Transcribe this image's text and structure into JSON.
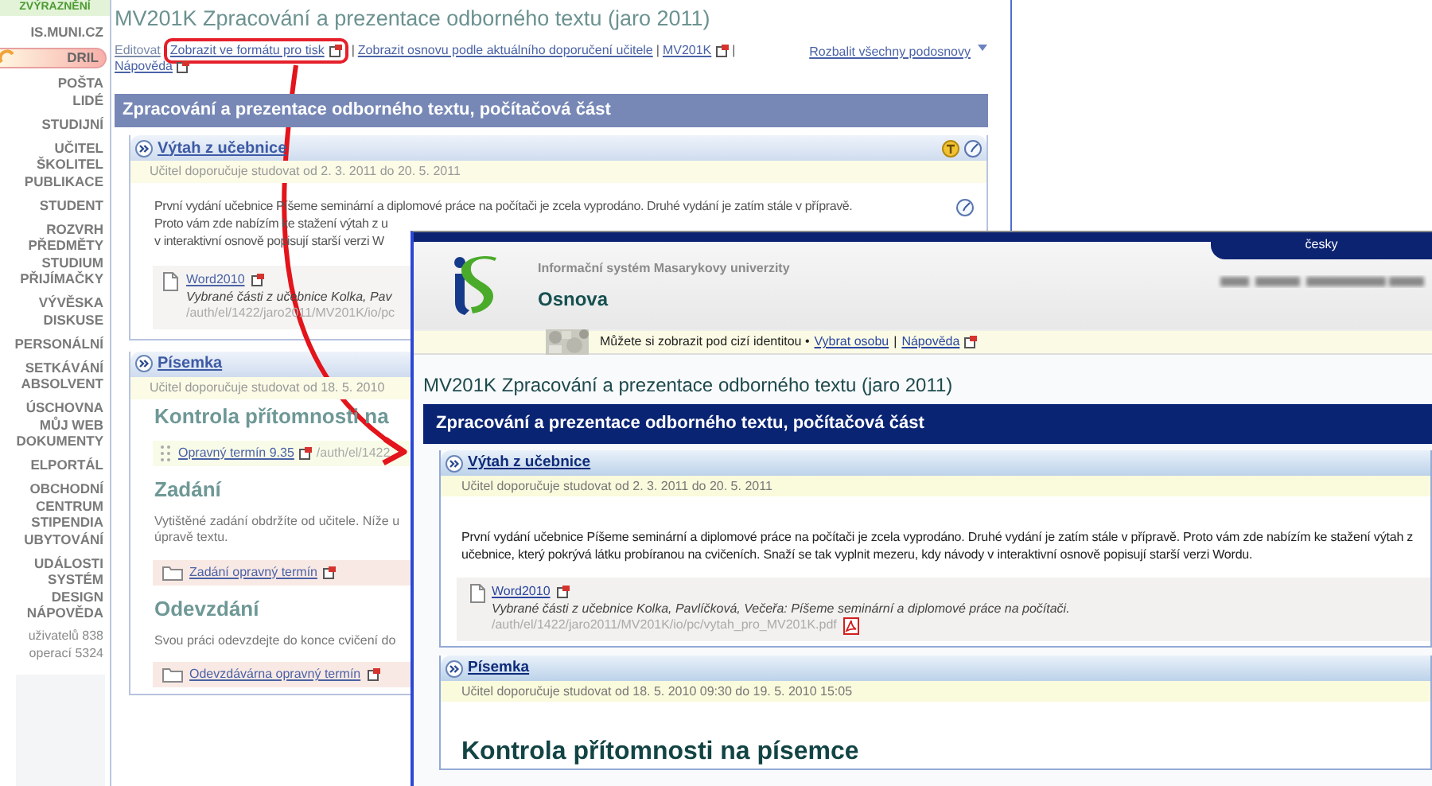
{
  "sidebar": {
    "top_label": "ZVÝRAZNĚNÍ",
    "groups": [
      [
        {
          "label": "IS.MUNI.CZ",
          "selected": false
        }
      ],
      [
        {
          "label": "DRIL",
          "selected": true
        }
      ],
      [
        {
          "label": "POŠTA",
          "selected": false
        },
        {
          "label": "LIDÉ",
          "selected": false
        }
      ],
      [
        {
          "label": "STUDIJNÍ",
          "selected": false
        }
      ],
      [
        {
          "label": "UČITEL",
          "selected": false
        },
        {
          "label": "ŠKOLITEL",
          "selected": false
        },
        {
          "label": "PUBLIKACE",
          "selected": false
        }
      ],
      [
        {
          "label": "STUDENT",
          "selected": false
        }
      ],
      [
        {
          "label": "ROZVRH",
          "selected": false
        },
        {
          "label": "PŘEDMĚTY",
          "selected": false
        },
        {
          "label": "STUDIUM",
          "selected": false
        },
        {
          "label": "PŘIJÍMAČKY",
          "selected": false
        }
      ],
      [
        {
          "label": "VÝVĚSKA",
          "selected": false
        },
        {
          "label": "DISKUSE",
          "selected": false
        }
      ],
      [
        {
          "label": "PERSONÁLNÍ",
          "selected": false
        }
      ],
      [
        {
          "label": "SETKÁVÁNÍ",
          "selected": false
        },
        {
          "label": "ABSOLVENT",
          "selected": false
        }
      ],
      [
        {
          "label": "ÚSCHOVNA",
          "selected": false
        },
        {
          "label": "MŮJ WEB",
          "selected": false
        },
        {
          "label": "DOKUMENTY",
          "selected": false
        }
      ],
      [
        {
          "label": "ELPORTÁL",
          "selected": false
        }
      ],
      [
        {
          "label": "OBCHODNÍ",
          "selected": false
        },
        {
          "label": "CENTRUM",
          "selected": false
        },
        {
          "label": "STIPENDIA",
          "selected": false
        },
        {
          "label": "UBYTOVÁNÍ",
          "selected": false
        }
      ],
      [
        {
          "label": "UDÁLOSTI",
          "selected": false
        },
        {
          "label": "SYSTÉM",
          "selected": false
        },
        {
          "label": "DESIGN",
          "selected": false
        },
        {
          "label": "NÁPOVĚDA",
          "selected": false
        }
      ]
    ],
    "stats": [
      "uživatelů 838",
      "operací 5324"
    ]
  },
  "page": {
    "title": "MV201K Zpracování a prezentace odborného textu (jaro 2011)",
    "links": [
      {
        "kind": "muted",
        "label": "Editovat",
        "external": false,
        "highlighted": false
      },
      {
        "kind": "link",
        "label": "Zobrazit ve formátu pro tisk",
        "external": true,
        "highlighted": true
      },
      {
        "kind": "separator",
        "label": "|"
      },
      {
        "kind": "link",
        "label": "Zobrazit osnovu podle aktuálního doporučení učitele",
        "external": false,
        "highlighted": false
      },
      {
        "kind": "separator",
        "label": "|"
      },
      {
        "kind": "link",
        "label": "MV201K",
        "external": true,
        "highlighted": false
      },
      {
        "kind": "separator",
        "label": "|"
      },
      {
        "kind": "link",
        "label": "Nápověda",
        "external": true,
        "highlighted": false
      }
    ],
    "expand_all": "Rozbalit všechny podosnovy",
    "section_title": "Zpracování a prezentace odborného textu, počítačová část",
    "block_1": {
      "title": "Výtah z učebnice",
      "recommended": "Učitel doporučuje studovat od 2. 3. 2011 do 20. 5. 2011",
      "lines": [
        "První vydání učebnice Píšeme seminární a diplomové práce na počítači je zcela vyprodáno. Druhé vydání je zatím stále v přípravě.",
        "Proto vám zde nabízím ke stažení výtah z u",
        "v interaktivní osnově popisují starší verzi W"
      ],
      "attachment": {
        "name": "Word2010",
        "description": "Vybrané části z učebnice Kolka, Pav",
        "path": "/auth/el/1422/jaro2011/MV201K/io/pc"
      }
    },
    "block_2": {
      "title": "Písemka",
      "recommended": "Učitel doporučuje studovat od 18. 5. 2010",
      "content": [
        {
          "kind": "heading",
          "text": "Kontrola přítomnosti na"
        },
        {
          "kind": "task",
          "text": "Opravný termín 9.35",
          "path": "/auth/el/1422"
        },
        {
          "kind": "heading",
          "text": "Zadání"
        },
        {
          "kind": "text",
          "lines": [
            "Vytištěné zadání obdržíte od učitele. Níže u",
            "úpravě textu."
          ]
        },
        {
          "kind": "folder",
          "text": "Zadání opravný termín"
        },
        {
          "kind": "heading",
          "text": "Odevzdání"
        },
        {
          "kind": "text",
          "lines": [
            "Svou práci odevzdejte do konce cvičení do"
          ]
        },
        {
          "kind": "folder",
          "text": "Odevzdávárna opravný termín"
        }
      ]
    }
  },
  "window": {
    "language_tab": "česky",
    "system_name": "Informační systém Masarykovy univerzity",
    "app_name": "Osnova",
    "identity_notice": "Můžete si zobrazit pod cizí identitou •",
    "identity_links": [
      {
        "label": "Vybrat osobu",
        "external": false
      },
      {
        "label": "Nápověda",
        "external": true
      }
    ],
    "separator": "|",
    "title": "MV201K Zpracování a prezentace odborného textu (jaro 2011)",
    "section_title": "Zpracování a prezentace odborného textu, počítačová část",
    "block_1": {
      "title": "Výtah z učebnice",
      "recommended": "Učitel doporučuje studovat od 2. 3. 2011 do 20. 5. 2011",
      "paragraph": "První vydání učebnice Píšeme seminární a diplomové práce na počítači je zcela vyprodáno. Druhé vydání je zatím stále v přípravě. Proto vám zde nabízím ke stažení výtah z učebnice, který pokrývá látku probíranou na cvičeních. Snaží se tak vyplnit mezeru, kdy návody v interaktivní osnově popisují starší verzi Wordu.",
      "attachment": {
        "name": "Word2010",
        "description": "Vybrané části z učebnice Kolka, Pavlíčková, Večeřa: Píšeme seminární a diplomové práce na počítači.",
        "path": "/auth/el/1422/jaro2011/MV201K/io/pc/vytah_pro_MV201K.pdf"
      }
    },
    "block_2": {
      "title": "Písemka",
      "recommended": "Učitel doporučuje studovat od 18. 5. 2010 09:30 do 19. 5. 2010 15:05",
      "heading": "Kontrola přítomnosti na písemce"
    }
  }
}
